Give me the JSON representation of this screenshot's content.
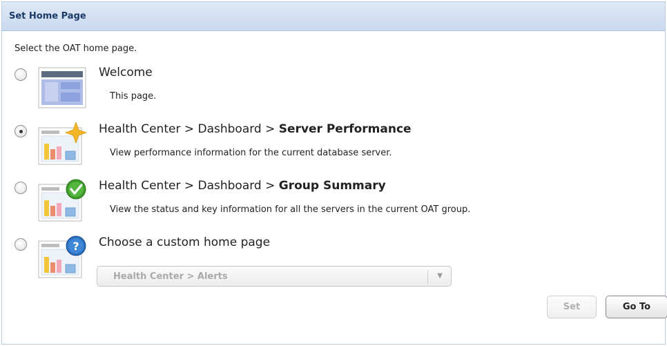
{
  "header": {
    "title": "Set Home Page"
  },
  "intro": "Select the OAT home page.",
  "options": [
    {
      "title": "Welcome",
      "title_bold": "",
      "description": "This page.",
      "checked": false,
      "thumbnail_icon": "welcome-page-icon"
    },
    {
      "title": "Health Center > Dashboard > ",
      "title_bold": "Server Performance",
      "description": "View performance information for the current database server.",
      "checked": true,
      "thumbnail_icon": "star-chart-icon"
    },
    {
      "title": "Health Center > Dashboard > ",
      "title_bold": "Group Summary",
      "description": "View the status and key information for all the servers in the current OAT group.",
      "checked": false,
      "thumbnail_icon": "checkmark-chart-icon"
    },
    {
      "title": "Choose a custom home page",
      "title_bold": "",
      "description": "",
      "checked": false,
      "thumbnail_icon": "question-chart-icon"
    }
  ],
  "custom_select": {
    "value": "Health Center > Alerts",
    "arrow_icon": "dropdown-arrow-icon"
  },
  "buttons": {
    "set_label": "Set",
    "goto_label": "Go To"
  },
  "colors": {
    "header_bg": "#d4e1f2",
    "header_text": "#1a3a66",
    "star": "#f2b628",
    "check": "#3c9a2b",
    "question": "#2a6fc0"
  }
}
